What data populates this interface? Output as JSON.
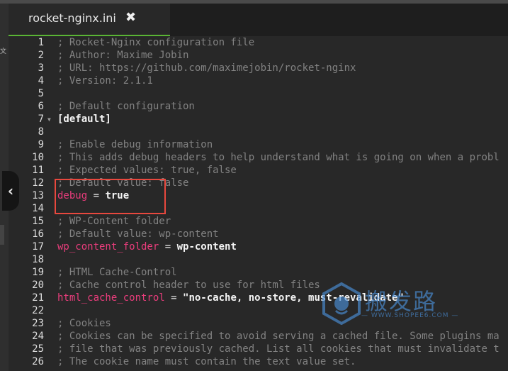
{
  "tab": {
    "title": "rocket-nginx.ini",
    "close_symbol": "✖"
  },
  "collapse": {
    "symbol": "‹"
  },
  "left_edge_mark": "文",
  "lines": [
    {
      "n": "1",
      "t": [
        [
          "c",
          "; Rocket-Nginx configuration file"
        ]
      ]
    },
    {
      "n": "2",
      "t": [
        [
          "c",
          "; Author: Maxime Jobin"
        ]
      ]
    },
    {
      "n": "3",
      "t": [
        [
          "c",
          "; URL: https://github.com/maximejobin/rocket-nginx"
        ]
      ]
    },
    {
      "n": "4",
      "t": [
        [
          "c",
          "; Version: 2.1.1"
        ]
      ]
    },
    {
      "n": "5",
      "t": []
    },
    {
      "n": "6",
      "t": [
        [
          "c",
          "; Default configuration"
        ]
      ]
    },
    {
      "n": "7",
      "fold": true,
      "t": [
        [
          "sec",
          "[default]"
        ]
      ]
    },
    {
      "n": "8",
      "t": []
    },
    {
      "n": "9",
      "t": [
        [
          "c",
          "; Enable debug information"
        ]
      ]
    },
    {
      "n": "10",
      "t": [
        [
          "c",
          "; This adds debug headers to help understand what is going on when a probl"
        ]
      ]
    },
    {
      "n": "11",
      "t": [
        [
          "c",
          "; Expected values: true, false"
        ]
      ]
    },
    {
      "n": "12",
      "t": [
        [
          "c",
          "; Default value: false"
        ]
      ]
    },
    {
      "n": "13",
      "t": [
        [
          "k",
          "debug"
        ],
        [
          "o",
          " = "
        ],
        [
          "v",
          "true"
        ]
      ]
    },
    {
      "n": "14",
      "t": []
    },
    {
      "n": "15",
      "t": [
        [
          "c",
          "; WP-Content folder"
        ]
      ]
    },
    {
      "n": "16",
      "t": [
        [
          "c",
          "; Default value: wp-content"
        ]
      ]
    },
    {
      "n": "17",
      "t": [
        [
          "k",
          "wp_content_folder"
        ],
        [
          "o",
          " = "
        ],
        [
          "v",
          "wp-content"
        ]
      ]
    },
    {
      "n": "18",
      "t": []
    },
    {
      "n": "19",
      "t": [
        [
          "c",
          "; HTML Cache-Control"
        ]
      ]
    },
    {
      "n": "20",
      "t": [
        [
          "c",
          "; Cache control header to use for html files"
        ]
      ]
    },
    {
      "n": "21",
      "t": [
        [
          "k",
          "html_cache_control"
        ],
        [
          "o",
          " = "
        ],
        [
          "s",
          "\"no-cache, no-store, must-revalidate\""
        ]
      ]
    },
    {
      "n": "22",
      "t": []
    },
    {
      "n": "23",
      "t": [
        [
          "c",
          "; Cookies"
        ]
      ]
    },
    {
      "n": "24",
      "t": [
        [
          "c",
          "; Cookies can be specified to avoid serving a cached file. Some plugins ma"
        ]
      ]
    },
    {
      "n": "25",
      "t": [
        [
          "c",
          "; file that was previously cached. List all cookies that must invalidate t"
        ]
      ]
    },
    {
      "n": "26",
      "t": [
        [
          "c",
          "; The cookie name must contain the text value set."
        ]
      ]
    }
  ],
  "watermark": {
    "text": "搬发路",
    "url": "— WWW.SHOPEE6.COM —"
  },
  "colors": {
    "accent": "#5ab534",
    "keyword": "#ea3d7c",
    "comment": "#828282",
    "highlight_box": "#e8483e",
    "watermark": "#4b8fd8"
  }
}
